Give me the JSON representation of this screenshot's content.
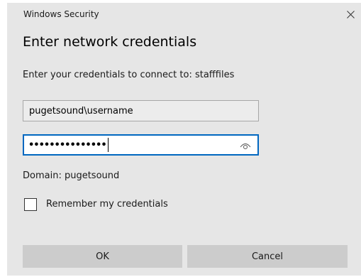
{
  "window": {
    "title": "Windows Security",
    "close_icon": "close-icon"
  },
  "dialog": {
    "heading": "Enter network credentials",
    "prompt": "Enter your credentials to connect to: stafffiles",
    "username_value": "pugetsound\\username",
    "password_mask": "•••••••••••••••",
    "password_focused": true,
    "reveal_icon": "eye-icon",
    "domain_text": "Domain: pugetsound",
    "remember_label": "Remember my credentials",
    "remember_checked": false
  },
  "buttons": {
    "ok_label": "OK",
    "cancel_label": "Cancel"
  },
  "colors": {
    "dialog_bg": "#e6e6e6",
    "focus_accent": "#0067c0",
    "button_bg": "#cccccc"
  }
}
